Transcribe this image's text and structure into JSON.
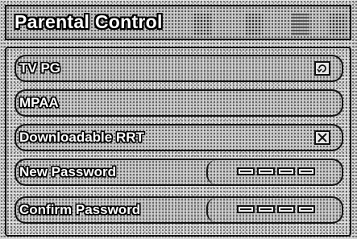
{
  "title": "Parental Control",
  "menu": {
    "items": [
      {
        "label": "TV PG",
        "icon": "refresh-arrow-icon"
      },
      {
        "label": "MPAA"
      },
      {
        "label": "Downloadable RRT",
        "icon": "x-box-icon"
      },
      {
        "label": "New Password",
        "password_mask_count": 4
      },
      {
        "label": "Confirm Password",
        "password_mask_count": 4
      }
    ]
  }
}
